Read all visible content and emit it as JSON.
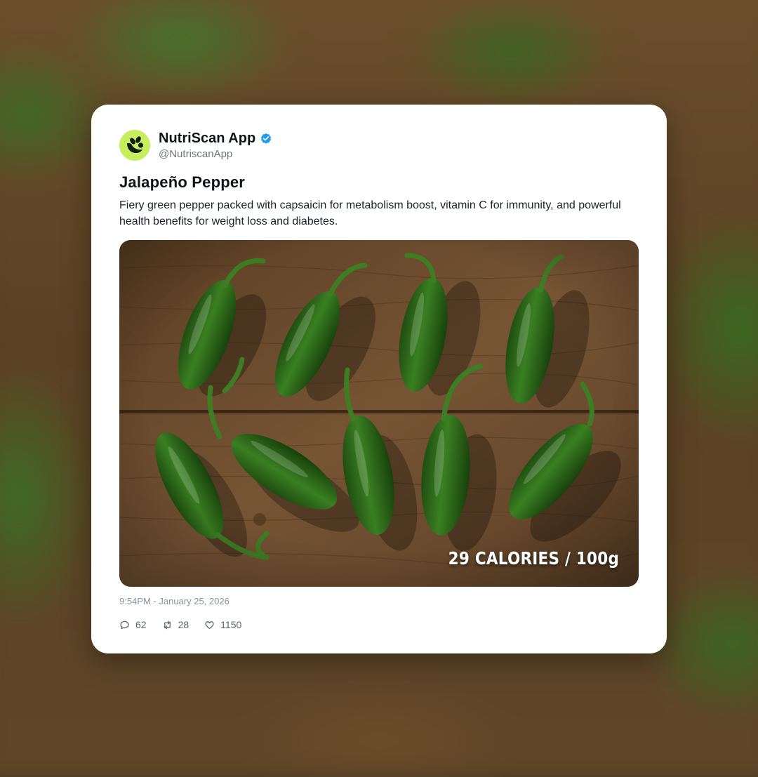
{
  "post": {
    "display_name": "NutriScan App",
    "handle": "@NutriscanApp",
    "verified": true,
    "title": "Jalapeño Pepper",
    "description": "Fiery green pepper packed with capsaicin for metabolism boost, vitamin C for immunity, and powerful health benefits for weight loss and diabetes.",
    "image_overlay": "29 CALORIES / 100g",
    "timestamp": "9:54PM - January 25, 2026",
    "stats": {
      "replies": "62",
      "reposts": "28",
      "likes": "1150"
    }
  },
  "icons": {
    "avatar": "nutriscan-logo-icon",
    "verified": "verified-badge-icon",
    "replies": "speech-bubble-icon",
    "reposts": "repost-arrows-icon",
    "likes": "heart-icon"
  },
  "colors": {
    "avatar_bg": "#c5ef5e",
    "verified_badge": "#1d9bf0",
    "pepper_green": "#2f6e1c",
    "wood": "#6a4a2a"
  }
}
